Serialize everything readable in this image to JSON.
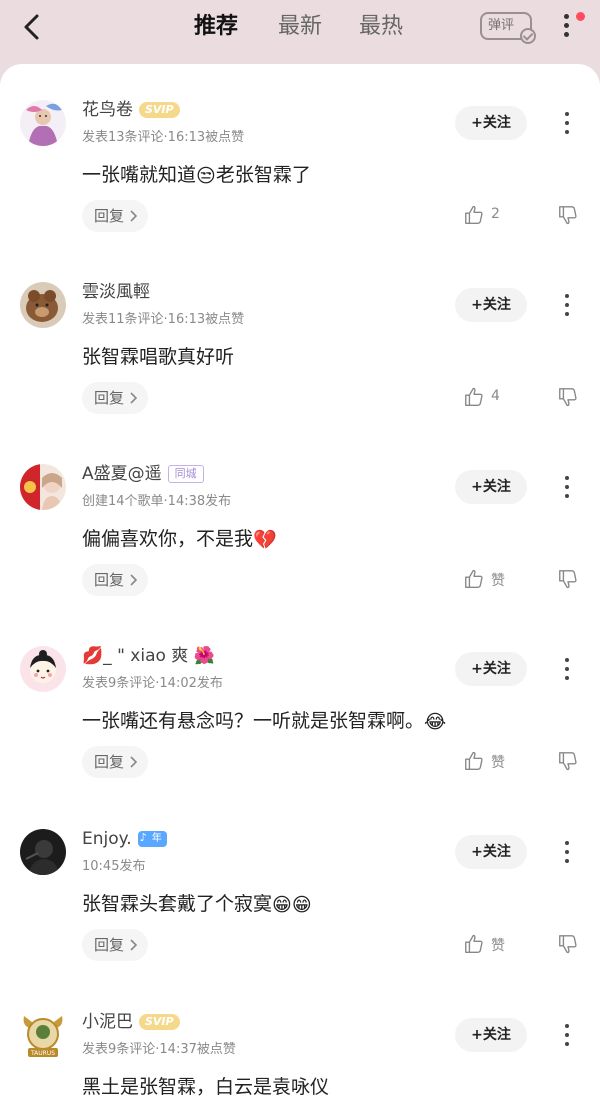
{
  "header": {
    "tabs": [
      {
        "label": "推荐",
        "active": true
      },
      {
        "label": "最新",
        "active": false
      },
      {
        "label": "最热",
        "active": false
      }
    ],
    "danmu_label": "弹评",
    "accent_dot_color": "#ff4d5e"
  },
  "comments": [
    {
      "username": "花鸟卷",
      "badge": "SVIP",
      "meta": "发表13条评论·16:13被点赞",
      "text_before": "一张嘴就知道",
      "emoji": "😒",
      "text_after": "老张智霖了",
      "follow_label": "+关注",
      "reply_label": "回复",
      "like_count": "2"
    },
    {
      "username": "雲淡風輕",
      "badge": "",
      "meta": "发表11条评论·16:13被点赞",
      "text_before": "张智霖唱歌真好听",
      "emoji": "",
      "text_after": "",
      "follow_label": "+关注",
      "reply_label": "回复",
      "like_count": "4"
    },
    {
      "username": "A盛夏@遥",
      "badge": "同城",
      "meta": "创建14个歌单·14:38发布",
      "text_before": "偏偏喜欢你，不是我",
      "emoji": "💔",
      "text_after": "",
      "follow_label": "+关注",
      "reply_label": "回复",
      "like_count": "赞"
    },
    {
      "username": "💋_ \" xiao 爽 🌺",
      "badge": "",
      "meta": "发表9条评论·14:02发布",
      "text_before": "一张嘴还有悬念吗？一听就是张智霖啊。",
      "emoji": "😂",
      "text_after": "",
      "follow_label": "+关注",
      "reply_label": "回复",
      "like_count": "赞"
    },
    {
      "username": "Enjoy.",
      "badge": "年",
      "meta": "10:45发布",
      "text_before": "张智霖头套戴了个寂寞",
      "emoji": "😁😁",
      "text_after": "",
      "follow_label": "+关注",
      "reply_label": "回复",
      "like_count": "赞"
    },
    {
      "username": "小泥巴",
      "badge": "SVIP",
      "meta": "发表9条评论·14:37被点赞",
      "text_before": "黑土是张智霖，白云是袁咏仪",
      "emoji": "",
      "text_after": "",
      "follow_label": "+关注",
      "reply_label": "回复",
      "like_count": ""
    }
  ],
  "avatar_badge_text": "TAURUS"
}
